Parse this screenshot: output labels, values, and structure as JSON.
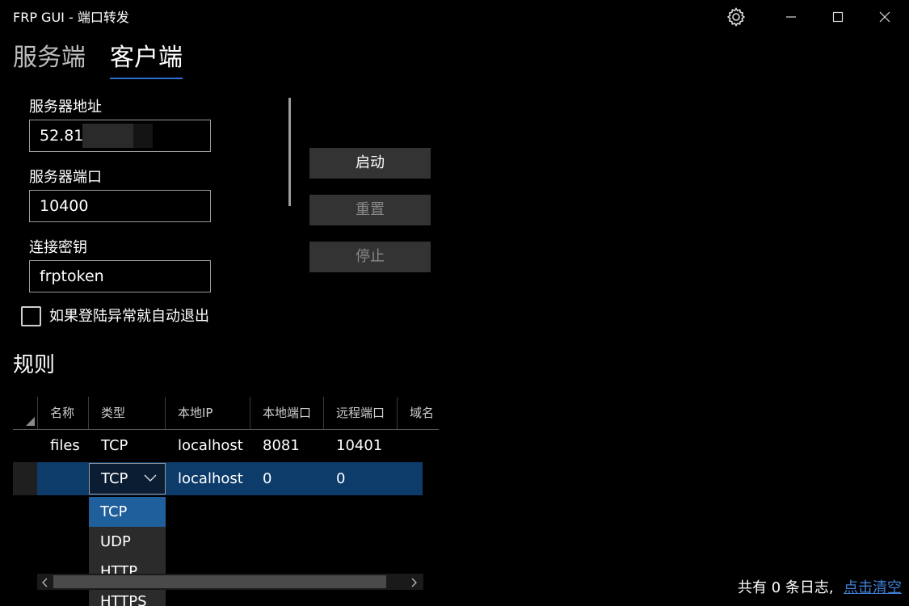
{
  "window": {
    "title": "FRP GUI - 端口转发"
  },
  "tabs": [
    {
      "label": "服务端",
      "active": false
    },
    {
      "label": "客户端",
      "active": true
    }
  ],
  "form": {
    "server_address": {
      "label": "服务器地址",
      "value": "52.81."
    },
    "server_port": {
      "label": "服务器端口",
      "value": "10400"
    },
    "token": {
      "label": "连接密钥",
      "value": "frptoken"
    },
    "auto_exit": {
      "label": "如果登陆异常就自动退出",
      "checked": false
    }
  },
  "buttons": {
    "start": "启动",
    "reset": "重置",
    "stop": "停止"
  },
  "rules": {
    "title": "规则",
    "columns": [
      "名称",
      "类型",
      "本地IP",
      "本地端口",
      "远程端口",
      "域名"
    ],
    "rows": [
      {
        "name": "files",
        "type": "TCP",
        "local_ip": "localhost",
        "local_port": "8081",
        "remote_port": "10401",
        "domain": ""
      },
      {
        "name": "",
        "type": "TCP",
        "local_ip": "localhost",
        "local_port": "0",
        "remote_port": "0",
        "domain": ""
      }
    ],
    "type_options": [
      "TCP",
      "UDP",
      "HTTP",
      "HTTPS"
    ],
    "selected_type": "TCP"
  },
  "footer": {
    "log_count_text": "共有 0 条日志,",
    "clear_link": "点击清空"
  },
  "colors": {
    "background": "#000000",
    "accent": "#2c6fd0",
    "selected_row": "#0d3b6a",
    "link": "#3f7fd6"
  }
}
